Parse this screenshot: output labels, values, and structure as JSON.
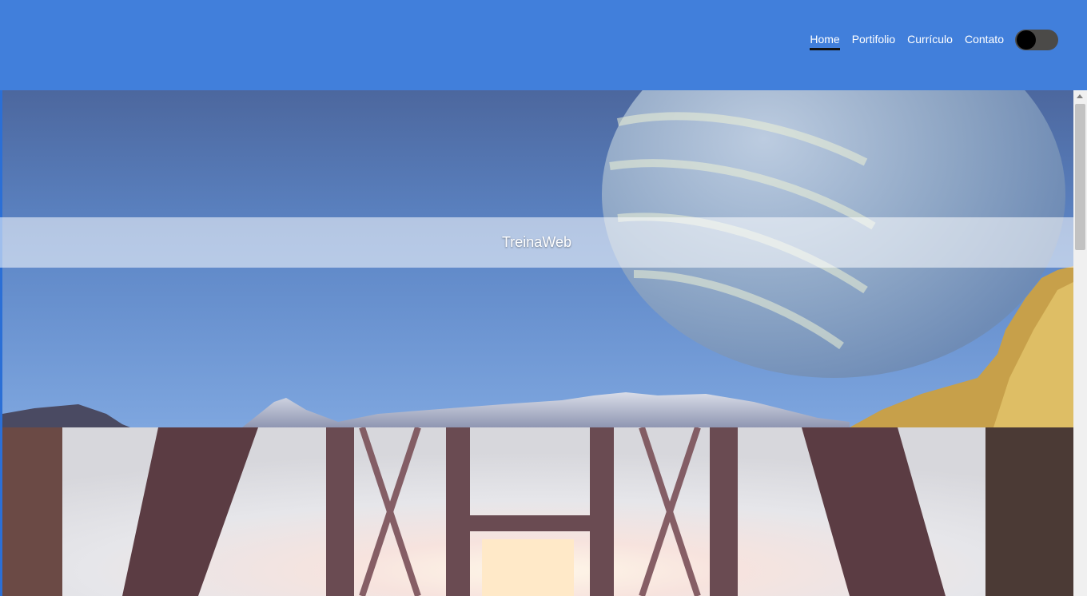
{
  "nav": {
    "items": [
      {
        "label": "Home",
        "active": true
      },
      {
        "label": "Portifolio",
        "active": false
      },
      {
        "label": "Currículo",
        "active": false
      },
      {
        "label": "Contato",
        "active": false
      }
    ],
    "theme_toggle": {
      "state": "off"
    }
  },
  "hero": {
    "title": "TreinaWeb"
  },
  "colors": {
    "header": "#417fdb",
    "active_underline": "#111111",
    "toggle_track": "#4b4a48"
  }
}
